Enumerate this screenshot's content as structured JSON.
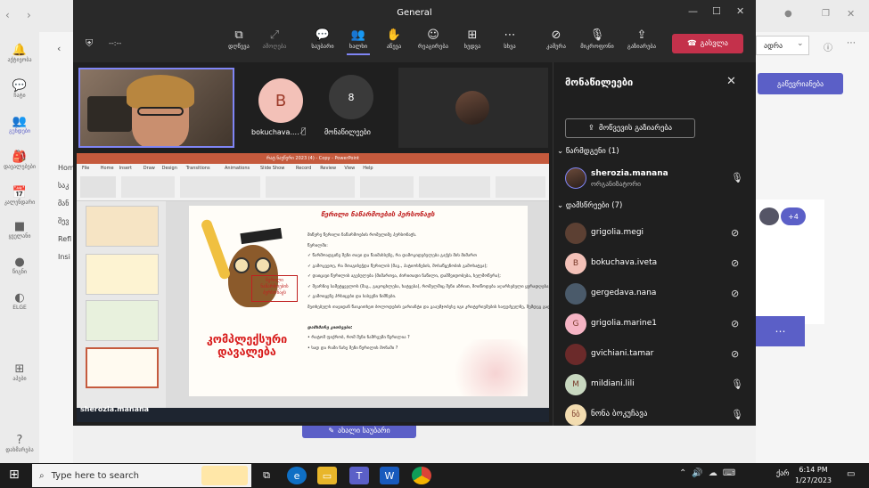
{
  "meeting": {
    "window_title": "General",
    "timer": "--:--",
    "toolbar": [
      {
        "icon": "share-screen-icon",
        "label": "დღწევა",
        "dim": false
      },
      {
        "icon": "popout-icon",
        "label": "ამოღება",
        "dim": true
      },
      {
        "icon": "chat-icon",
        "label": "საუბარი",
        "dim": false
      },
      {
        "icon": "people-icon",
        "label": "ხალხი",
        "dim": false,
        "active": true
      },
      {
        "icon": "raise-hand-icon",
        "label": "აწევა",
        "dim": false
      },
      {
        "icon": "reaction-icon",
        "label": "რეაგირება",
        "dim": false
      },
      {
        "icon": "view-icon",
        "label": "ხედვა",
        "dim": false
      },
      {
        "icon": "more-icon",
        "label": "სხვა",
        "dim": false
      },
      {
        "icon": "camera-off-icon",
        "label": "კამერა",
        "dim": false
      },
      {
        "icon": "mic-off-icon",
        "label": "მიკროფონი",
        "dim": false
      },
      {
        "icon": "share-icon",
        "label": "გაზიარება",
        "dim": false
      }
    ],
    "leave_label": "გასვლა"
  },
  "stage": {
    "tile_b_initial": "B",
    "tile_b_name": "bokuchava....",
    "tile_count": "8",
    "tile_count_label": "მონაწილეები",
    "presenter_name": "sherozia.manana"
  },
  "slide": {
    "red_title": "კომპლექსური დავალება",
    "heading": "წერილი ნაწარმოების პერსონაჟს",
    "owl_caption": "წერილი ნაწარმოების პერსონაჟს",
    "lines": [
      "მიწერე წერილი ნაწარმოების რომელიმე პერსონაჟს.",
      "წერილში:",
      "✓ წარმოადგინე შენი თავი და წაიმახსენე, რა დამოკიდებულება გაქვს მის მიმართ",
      "✓ გამოკვეთე, რა შთაგიბეჭდა წერილის (მაგ., პატიოსნების, მოსაწყენობის გამოხატვა);",
      "✓ დაიცავი წერილის აგებულება (მიმართვა, ძირითადი ნაწილი, დამშვიდობება, ხელმოწერა);",
      "✓ შეარჩიე სამეტყველოს (მაგ., გაცოცხლება, ხატვება), რომელშიც შენი აზრით, მოიწოდება აღარსებული ყურადღება;",
      "✓ გამოიყენე პრსიცები და სასვენი ნიშნები.",
      "მეთხებულს თავიდან წაიკითხეთ ბოლოდების ვარიანტი და გააუმჯობესე იგი კრიტერიუმების საფუძველზე, შემდეგ გადაწერე და გააფორმე.",
      "",
      "დამხმარე კითხვები:",
      "• რატომ ფიქრობ, რომ შენი ნაშრეუმი წერილია ?",
      "• სად და რამი ნახე შენი წერილის მონაში ?"
    ],
    "app_title": "რატ ნაუწერი 2023 (4) - Copy - PowerPoint",
    "menu": [
      "File",
      "Home",
      "Insert",
      "Draw",
      "Design",
      "Transitions",
      "Animations",
      "Slide Show",
      "Record",
      "Review",
      "View",
      "Help"
    ]
  },
  "participants": {
    "title": "მონაწილეები",
    "share_invite": "მოწვევის გაზიარება",
    "presenters_header": "წარმდგენი (1)",
    "attendees_header": "დამსწრეები (7)",
    "presenter": {
      "name": "sherozia.manana",
      "role": "ორგანიზატორი",
      "mic": "on"
    },
    "attendees": [
      {
        "name": "grigolia.megi",
        "initial": "",
        "color": "#5c4033",
        "mic": "off"
      },
      {
        "name": "bokuchava.iveta",
        "initial": "B",
        "color": "#f3c1b8",
        "mic": "off"
      },
      {
        "name": "gergedava.nana",
        "initial": "",
        "color": "#4a5a6a",
        "mic": "off"
      },
      {
        "name": "grigolia.marine1",
        "initial": "G",
        "color": "#f5b4c4",
        "mic": "off"
      },
      {
        "name": "gvichiani.tamar",
        "initial": "",
        "color": "#6b2a2a",
        "mic": "off"
      },
      {
        "name": "mildiani.lili",
        "initial": "M",
        "color": "#c8d8c0",
        "mic": "on"
      },
      {
        "name": "ნონა ბოკუჩავა",
        "initial": "ნბ",
        "color": "#f2dcb0",
        "mic": "on"
      }
    ]
  },
  "teams_bg": {
    "rail": [
      {
        "icon": "bell-icon",
        "label": "აქტივობა"
      },
      {
        "icon": "chat-icon",
        "label": "ჩატი"
      },
      {
        "icon": "teams-icon",
        "label": "გუნდები",
        "active": true
      },
      {
        "icon": "assignments-icon",
        "label": "დავალებები"
      },
      {
        "icon": "calendar-icon",
        "label": "კალენდარი"
      },
      {
        "icon": "onenote-icon",
        "label": "ყველანი"
      },
      {
        "icon": "mascot-icon",
        "label": "წიგნი"
      },
      {
        "icon": "elge-icon",
        "label": "ELGE"
      },
      {
        "icon": "apps-icon",
        "label": "აპები"
      },
      {
        "icon": "help-icon",
        "label": "დახმარება"
      }
    ],
    "list_items": [
      "Home",
      "საკ",
      "მან",
      "შევ",
      "Refl",
      "Insi"
    ],
    "join_label": "გაწევრიანება",
    "plus_count": "+4",
    "new_conversation": "ახალი საუბარი",
    "right_snippet": "ადრა"
  },
  "taskbar": {
    "search_placeholder": "Type here to search",
    "time": "6:14 PM",
    "date": "1/27/2023",
    "lang": "ქარ"
  }
}
